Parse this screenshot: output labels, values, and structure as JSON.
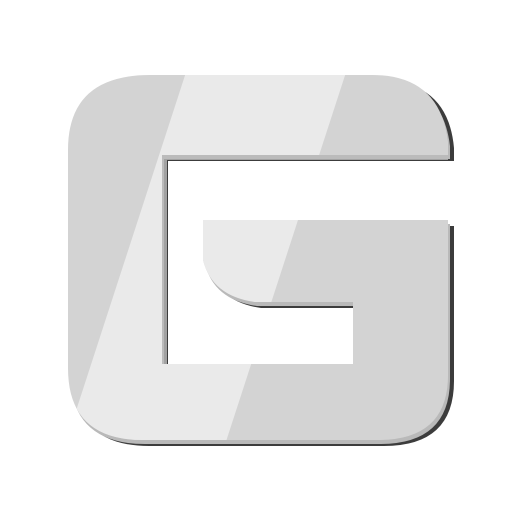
{
  "icon": {
    "name": "g-letter-logo-icon",
    "colors": {
      "background": "#ffffff",
      "face": "#d3d3d3",
      "face_highlight": "#eaeaea",
      "edge_light": "#bdbdbd",
      "edge_dark": "#3c3c3c"
    }
  }
}
